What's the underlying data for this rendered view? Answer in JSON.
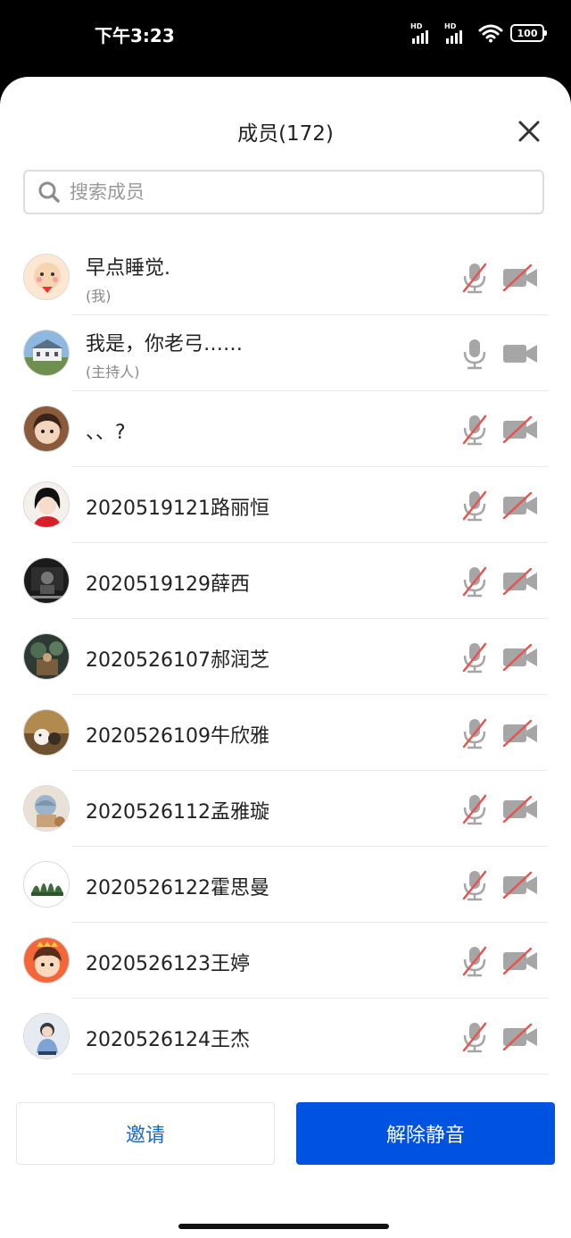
{
  "status_bar": {
    "time": "下午3:23",
    "signal1_label": "HD",
    "signal2_label": "HD",
    "battery": "100"
  },
  "header": {
    "title": "成员(172)",
    "close_icon": "close-icon"
  },
  "search": {
    "placeholder": "搜索成员",
    "value": ""
  },
  "members": [
    {
      "name": "早点睡觉.",
      "sub": "(我)",
      "mic": "muted",
      "camera": "off"
    },
    {
      "name": "我是，你老弓……",
      "sub": "(主持人)",
      "mic": "on",
      "camera": "on"
    },
    {
      "name": "、、?",
      "sub": "",
      "mic": "muted",
      "camera": "off"
    },
    {
      "name": "2020519121路丽恒",
      "sub": "",
      "mic": "muted",
      "camera": "off"
    },
    {
      "name": "2020519129薛西",
      "sub": "",
      "mic": "muted",
      "camera": "off"
    },
    {
      "name": "2020526107郝润芝",
      "sub": "",
      "mic": "muted",
      "camera": "off"
    },
    {
      "name": "2020526109牛欣雅",
      "sub": "",
      "mic": "muted",
      "camera": "off"
    },
    {
      "name": "2020526112孟雅璇",
      "sub": "",
      "mic": "muted",
      "camera": "off"
    },
    {
      "name": "2020526122霍思曼",
      "sub": "",
      "mic": "muted",
      "camera": "off"
    },
    {
      "name": "2020526123王婷",
      "sub": "",
      "mic": "muted",
      "camera": "off"
    },
    {
      "name": "2020526124王杰",
      "sub": "",
      "mic": "muted",
      "camera": "off"
    }
  ],
  "footer": {
    "invite_label": "邀请",
    "unmute_label": "解除静音"
  },
  "colors": {
    "primary": "#0052e0",
    "invite_text": "#1a66cc",
    "muted_slash": "#e8534f",
    "icon_gray": "#a6a6a6"
  }
}
